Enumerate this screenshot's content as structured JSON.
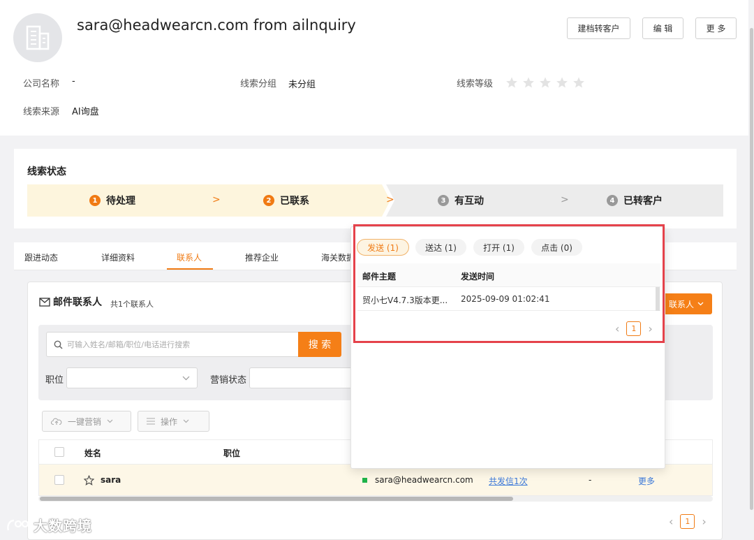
{
  "header": {
    "title": "sara@headwearcn.com from ailnquiry",
    "buttons": {
      "archive": "建档转客户",
      "edit": "编 辑",
      "more": "更 多"
    },
    "fields": {
      "company_label": "公司名称",
      "company_value": "-",
      "group_label": "线索分组",
      "group_value": "未分组",
      "level_label": "线索等级",
      "source_label": "线索来源",
      "source_value": "AI询盘"
    },
    "rating": {
      "value": 0,
      "max": 5
    }
  },
  "status": {
    "title": "线索状态",
    "steps": [
      {
        "num": "1",
        "label": "待处理"
      },
      {
        "num": "2",
        "label": "已联系"
      },
      {
        "num": "3",
        "label": "有互动"
      },
      {
        "num": "4",
        "label": "已转客户"
      }
    ],
    "arrow": ">",
    "accent": "#f07a13"
  },
  "tabs": [
    "跟进动态",
    "详细资料",
    "联系人",
    "推荐企业",
    "海关数据"
  ],
  "active_tab": "联系人",
  "contacts": {
    "title": "邮件联系人",
    "count": "共1个联系人",
    "add_label": "联系人",
    "search_placeholder": "可输入姓名/邮箱/职位/电话进行搜索",
    "search_button": "搜 索",
    "position_label": "职位",
    "marketing_label": "营销状态",
    "actions": {
      "bulk_marketing": "一键营销",
      "operate": "操作"
    },
    "columns": {
      "name": "姓名",
      "position": "职位"
    },
    "rows": [
      {
        "name": "sara",
        "email": "sara@headwearcn.com",
        "sent": "共发信1次",
        "dash": "-",
        "more": "更多"
      }
    ],
    "page": "1"
  },
  "popup": {
    "tabs": [
      "发送 (1)",
      "送达 (1)",
      "打开 (1)",
      "点击 (0)"
    ],
    "columns": {
      "subject": "邮件主题",
      "time": "发送时间"
    },
    "rows": [
      {
        "subject": "贸小七V4.7.3版本更...",
        "time": "2025-09-09 01:02:41"
      }
    ],
    "page": "1"
  },
  "watermark": "大数跨境"
}
